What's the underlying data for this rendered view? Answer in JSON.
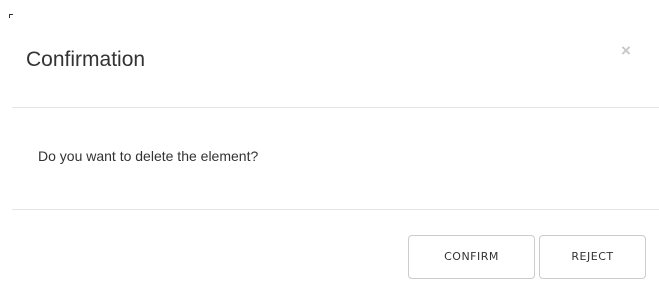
{
  "dialog": {
    "title": "Confirmation",
    "close_icon": "×",
    "message": "Do you want to delete the element?",
    "buttons": {
      "confirm_label": "CONFIRM",
      "reject_label": "REJECT"
    }
  }
}
